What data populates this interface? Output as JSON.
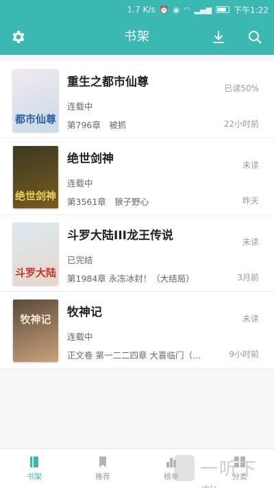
{
  "status_bar": {
    "speed": "1.7 K/s",
    "time": "下午1:22"
  },
  "app_bar": {
    "title": "书架",
    "icons": [
      "gear-icon",
      "download-icon",
      "search-icon"
    ]
  },
  "books": [
    {
      "title": "重生之都市仙尊",
      "status": "连载中",
      "chapter": "第796章　被抓",
      "progress": "已读50%",
      "time": "22小时前",
      "cover_text": "都市仙尊",
      "cover_colors": [
        "#f3e9ef",
        "#c7dbe8"
      ]
    },
    {
      "title": "绝世剑神",
      "status": "连载中",
      "chapter": "第3561章　狼子野心",
      "progress": "未读",
      "time": "昨天",
      "cover_text": "绝世剑神",
      "cover_colors": [
        "#3b3a22",
        "#7a5a20"
      ]
    },
    {
      "title": "斗罗大陆III龙王传说",
      "status": "已完结",
      "chapter": "第1984章 永冻冰封！（大结局）",
      "progress": "未读",
      "time": "3月前",
      "cover_text": "斗罗大陆",
      "cover_colors": [
        "#dce9f2",
        "#e7d6c8"
      ]
    },
    {
      "title": "牧神记",
      "status": "连载中",
      "chapter": "正文卷 第一二二四章 大喜临门（...",
      "progress": "未读",
      "time": "9小时前",
      "cover_text": "牧神记",
      "cover_colors": [
        "#5b4a3c",
        "#c9a27a"
      ]
    }
  ],
  "bottom_nav": [
    {
      "label": "书架",
      "icon": "bookshelf-icon",
      "active": true
    },
    {
      "label": "推荐",
      "icon": "bookmark-icon",
      "active": false
    },
    {
      "label": "榜单",
      "icon": "ranking-icon",
      "active": false
    },
    {
      "label": "分类",
      "icon": "category-icon",
      "active": false
    }
  ],
  "watermark": "一听下载",
  "colors": {
    "accent": "#3cb8b2",
    "background": "#f7f7f7"
  }
}
